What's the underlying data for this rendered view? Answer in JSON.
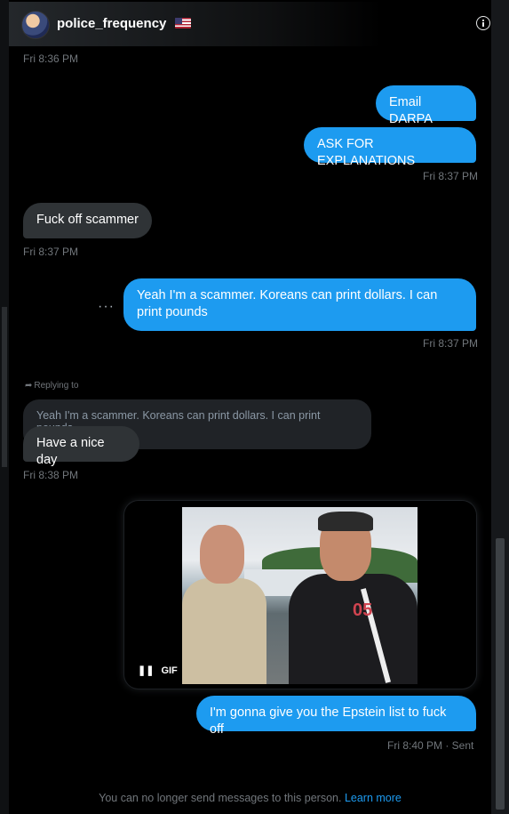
{
  "header": {
    "username": "police_frequency",
    "flag_icon": "us-flag-emoji",
    "info_icon": "info-circle-icon"
  },
  "messages": [
    {
      "ts": "Fri 8:36 PM"
    },
    {
      "out_1": "Email DARPA",
      "out_2": "ASK FOR EXPLANATIONS",
      "ts": "Fri 8:37 PM"
    },
    {
      "text": "Fuck off scammer",
      "ts": "Fri 8:37 PM"
    },
    {
      "more": "···",
      "text": "Yeah I'm a scammer. Koreans can print dollars. I can print pounds",
      "ts": "Fri 8:37 PM"
    },
    {
      "reply_label": "Replying to",
      "quoted": "Yeah I'm a scammer. Koreans can print dollars. I can print pounds",
      "text": "Have a nice day",
      "ts": "Fri 8:38 PM"
    },
    {
      "gif_label": "GIF",
      "text": "I'm gonna give you the Epstein list to fuck off",
      "ts": "Fri 8:40 PM · Sent"
    }
  ],
  "footer": {
    "text": "You can no longer send messages to this person.",
    "link": "Learn more"
  },
  "colors": {
    "accent": "#1d9bf0",
    "incoming": "#2f3336",
    "background": "#000000"
  }
}
